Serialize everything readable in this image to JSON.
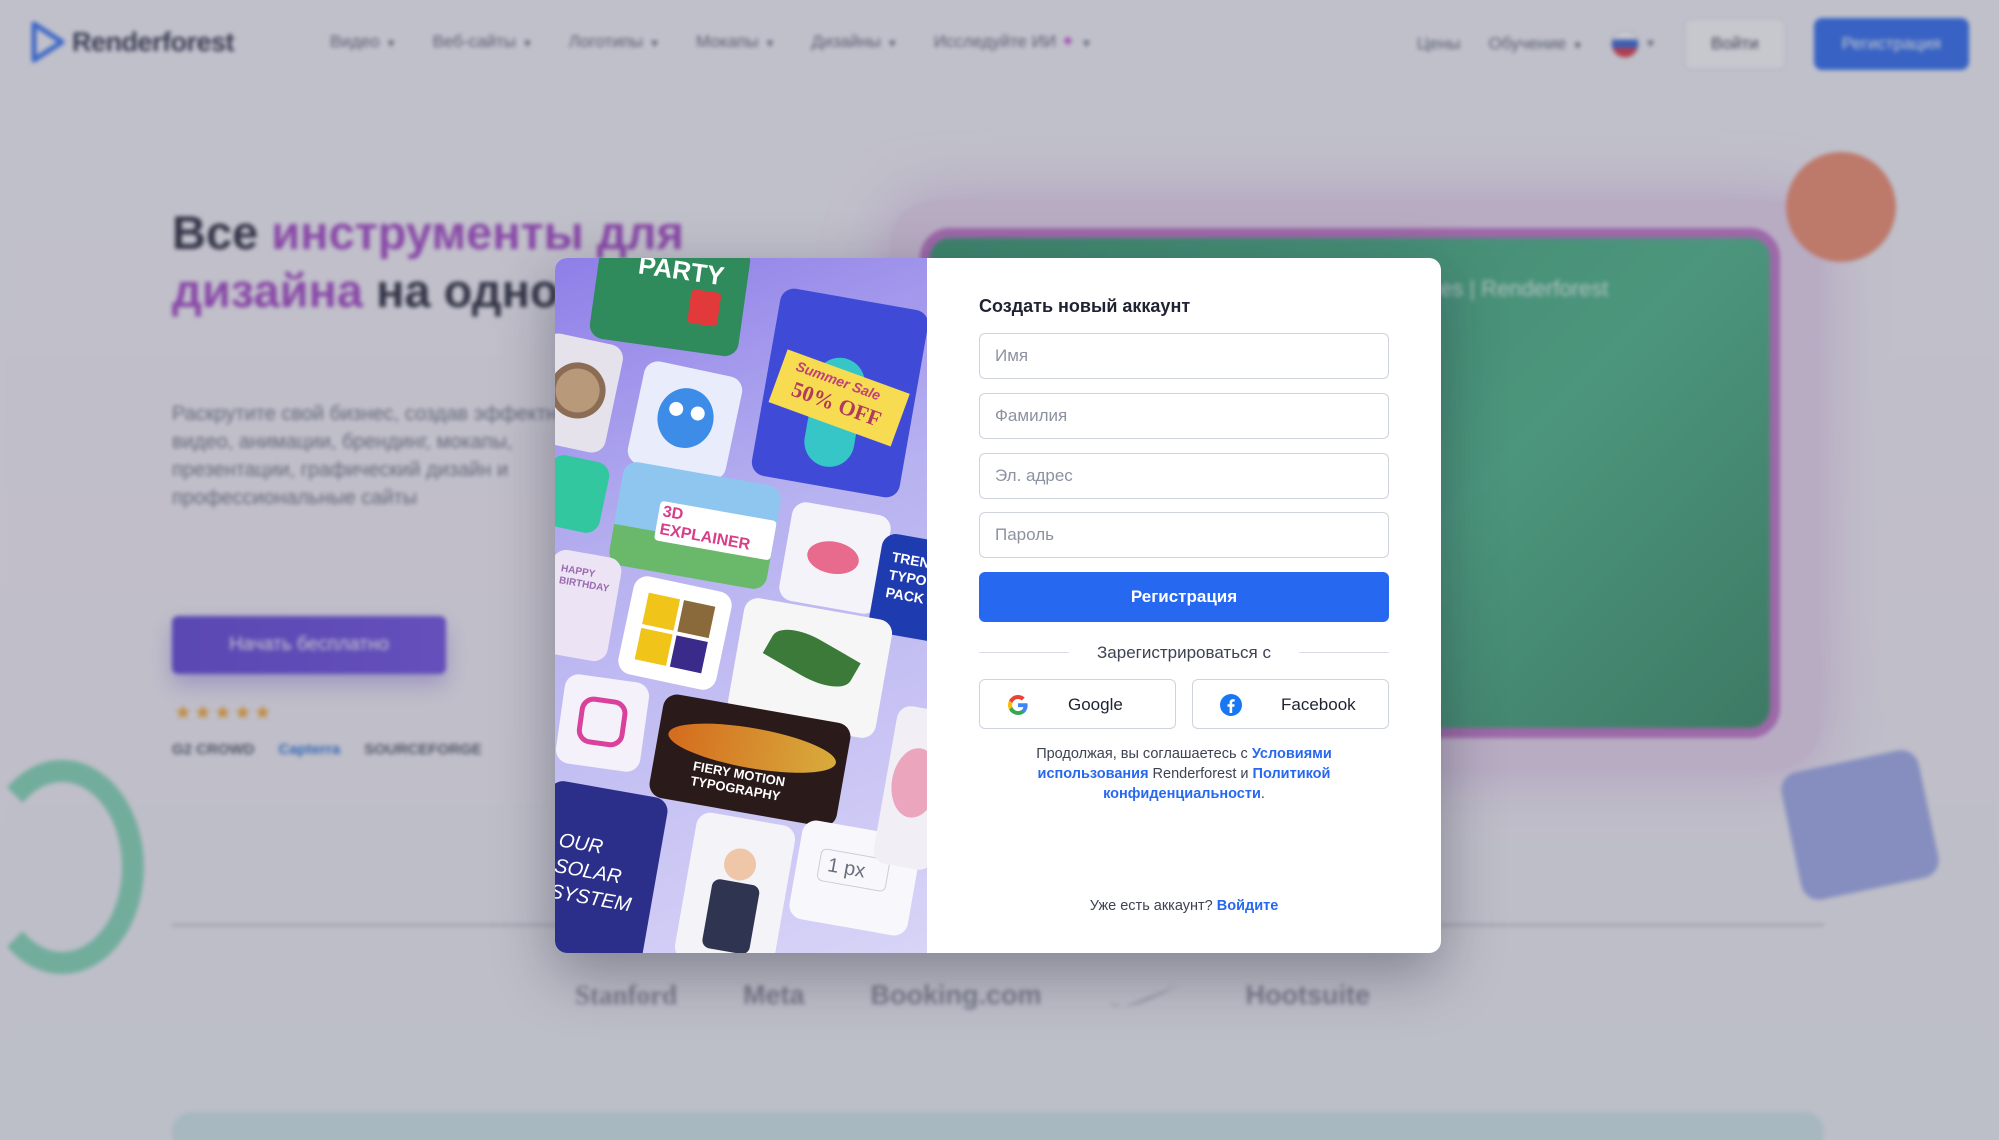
{
  "background": {
    "logo_text": "Renderforest",
    "nav": [
      "Видео",
      "Веб-сайты",
      "Логотипы",
      "Мокапы",
      "Дизайны",
      "Исследуйте ИИ"
    ],
    "nav_right": {
      "pricing": "Цены",
      "learning": "Обучение",
      "login": "Войти",
      "signup": "Регистрация"
    },
    "hero": {
      "title_part1": "Все ",
      "title_accent": "инструменты для дизайна",
      "title_part2": " на одной платформе",
      "subtitle": "Раскрутите свой бизнес, создав эффектные видео, анимации, брендинг, мокапы, презентации, графический дизайн и профессиональные сайты",
      "cta": "Начать бесплатно",
      "stars": "★★★★★",
      "ratings": [
        "G2 CROWD",
        "Capterra",
        "SOURCEFORGE"
      ]
    },
    "screen_text": "es | Renderforest",
    "brands": [
      "Stanford",
      "Meta",
      "Booking.com",
      "Hootsuite"
    ]
  },
  "tiles": {
    "party": "PARTY",
    "summer_sale": "Summer Sale",
    "summer_discount": "50% OFF",
    "explainer": "3D EXPLAINER",
    "birthday": "HAPPY BIRTHDAY",
    "typo_pack": "TRENDY TYPO PACK",
    "fiery": "FIERY MOTION TYPOGRAPHY",
    "solar": "OUR SOLAR SYSTEM",
    "px_value": "1 px"
  },
  "modal": {
    "title": "Создать новый аккаунт",
    "fields": {
      "first_name": "Имя",
      "last_name": "Фамилия",
      "email": "Эл. адрес",
      "password": "Пароль"
    },
    "submit": "Регистрация",
    "separator": "Зарегистрироваться с",
    "google": "Google",
    "facebook": "Facebook",
    "terms_prefix": "Продолжая, вы соглашаетесь с ",
    "terms_link": "Условиями использования",
    "terms_mid": " Renderforest и ",
    "privacy_link": "Политикой конфиденциальности",
    "terms_suffix": ".",
    "have_account": "Уже есть аккаунт? ",
    "login_link": "Войдите"
  },
  "colors": {
    "primary": "#2768f0",
    "accent": "#a03fc4",
    "text": "#1f2233"
  }
}
